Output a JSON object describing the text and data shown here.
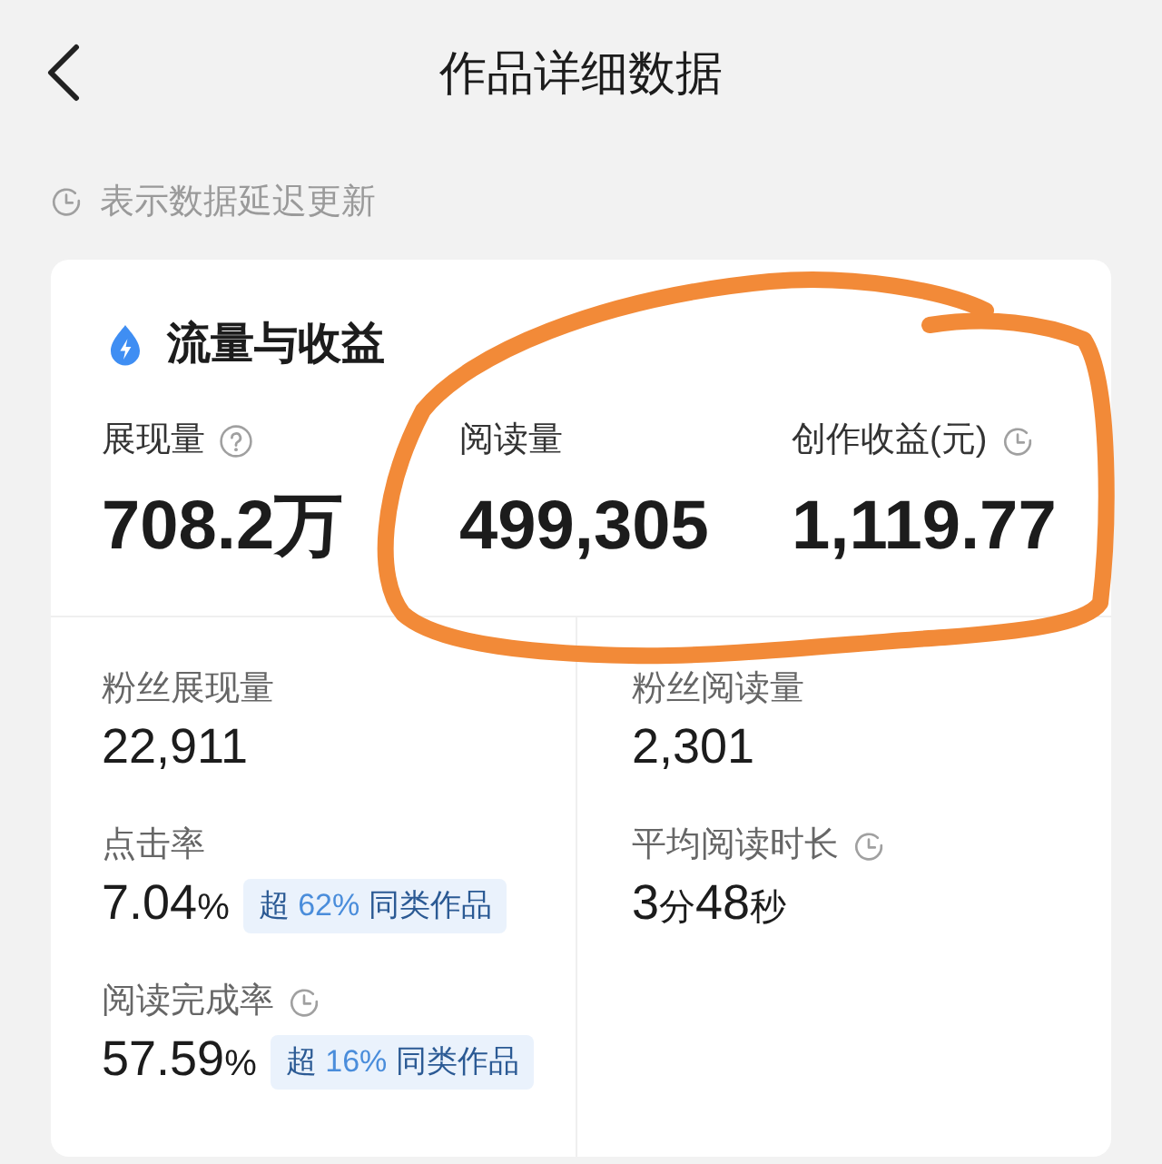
{
  "header": {
    "title": "作品详细数据"
  },
  "legend": {
    "text": "表示数据延迟更新"
  },
  "card": {
    "title": "流量与收益",
    "primary_metrics": [
      {
        "label": "展现量",
        "value": "708.2万",
        "help": true,
        "delayed": false
      },
      {
        "label": "阅读量",
        "value": "499,305",
        "help": false,
        "delayed": false
      },
      {
        "label": "创作收益(元)",
        "value": "1,119.77",
        "help": false,
        "delayed": true
      }
    ],
    "secondary_metrics": [
      {
        "label": "粉丝展现量",
        "value_parts": [
          {
            "text": "22,911",
            "kind": "number"
          }
        ],
        "delayed": false
      },
      {
        "label": "粉丝阅读量",
        "value_parts": [
          {
            "text": "2,301",
            "kind": "number"
          }
        ],
        "delayed": false
      },
      {
        "label": "点击率",
        "value_parts": [
          {
            "text": "7.04",
            "kind": "number"
          },
          {
            "text": "%",
            "kind": "unit"
          }
        ],
        "delayed": false,
        "comparison": [
          {
            "text": "超 ",
            "kind": "plain"
          },
          {
            "text": "62%",
            "kind": "figure"
          },
          {
            "text": " 同类作品",
            "kind": "plain"
          }
        ]
      },
      {
        "label": "平均阅读时长",
        "value_parts": [
          {
            "text": "3",
            "kind": "number"
          },
          {
            "text": "分",
            "kind": "unit"
          },
          {
            "text": "48",
            "kind": "number"
          },
          {
            "text": "秒",
            "kind": "unit"
          }
        ],
        "delayed": true
      },
      {
        "label": "阅读完成率",
        "value_parts": [
          {
            "text": "57.59",
            "kind": "number"
          },
          {
            "text": "%",
            "kind": "unit"
          }
        ],
        "delayed": true,
        "comparison": [
          {
            "text": "超 ",
            "kind": "plain"
          },
          {
            "text": "16%",
            "kind": "figure"
          },
          {
            "text": " 同类作品",
            "kind": "plain"
          }
        ]
      }
    ]
  }
}
